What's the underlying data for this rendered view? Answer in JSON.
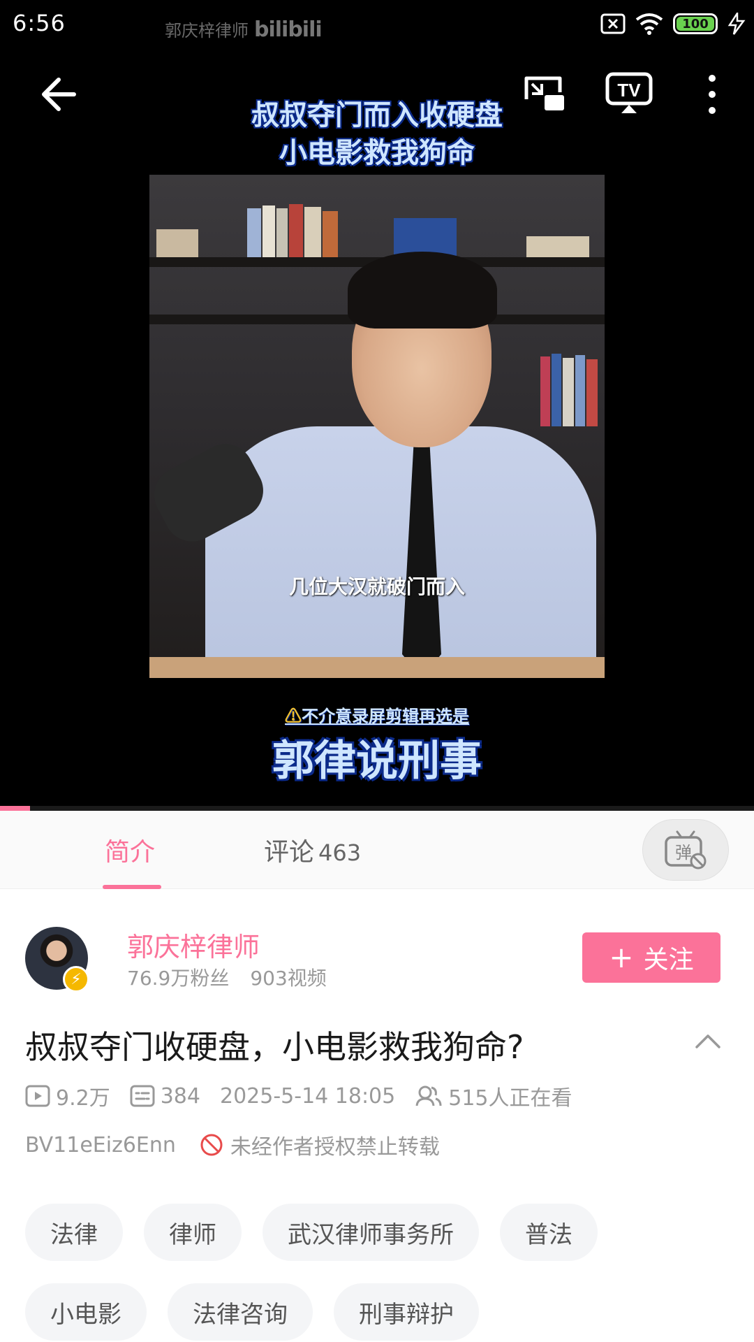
{
  "status_bar": {
    "time": "6:56",
    "watermark_text": "郭庆梓律师",
    "watermark_logo": "bilibili",
    "battery": "100"
  },
  "player": {
    "caption_line1": "叔叔夺门而入收硬盘",
    "caption_line2": "小电影救我狗命",
    "frame_subtitle": "几位大汉就破门而入",
    "warning_icon": "⚠",
    "warning_text": "不介意录屏剪辑再选是",
    "brand": "郭律说刑事",
    "progress_fraction": 0.04
  },
  "tabs": {
    "intro": "简介",
    "comments_label": "评论",
    "comments_count": "463",
    "danmu_icon": "弹"
  },
  "uploader": {
    "name": "郭庆梓律师",
    "fans": "76.9万粉丝",
    "videos": "903视频",
    "follow_label": "关注",
    "follow_plus": "+",
    "badge": "⚡"
  },
  "video": {
    "title": "叔叔夺门收硬盘，小电影救我狗命?",
    "views": "9.2万",
    "danmaku": "384",
    "date": "2025-5-14 18:05",
    "watching": "515人正在看",
    "bvid": "BV11eEiz6Enn",
    "copyright": "未经作者授权禁止转载"
  },
  "tags": [
    [
      "法律",
      "律师",
      "武汉律师事务所",
      "普法"
    ],
    [
      "小电影",
      "法律咨询",
      "刑事辩护"
    ]
  ],
  "colors": {
    "accent": "#fb7299",
    "muted": "#999999",
    "tag_bg": "#f4f5f7"
  }
}
